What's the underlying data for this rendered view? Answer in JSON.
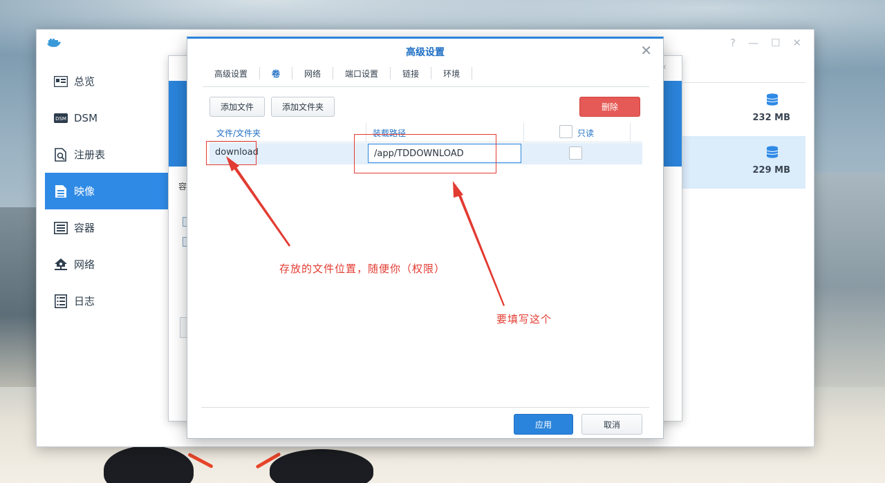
{
  "main_window": {
    "sidebar": [
      {
        "label": "总览",
        "icon": "overview-icon"
      },
      {
        "label": "DSM",
        "icon": "dsm-icon"
      },
      {
        "label": "注册表",
        "icon": "registry-icon"
      },
      {
        "label": "映像",
        "icon": "image-icon"
      },
      {
        "label": "容器",
        "icon": "container-icon"
      },
      {
        "label": "网络",
        "icon": "network-icon"
      },
      {
        "label": "日志",
        "icon": "log-icon"
      }
    ],
    "active_item": "映像",
    "image_sizes": [
      "232 MB",
      "229 MB"
    ]
  },
  "background_window": {
    "partial_label": "容"
  },
  "dialog": {
    "title": "高级设置",
    "tabs": [
      "高级设置",
      "卷",
      "网络",
      "端口设置",
      "链接",
      "环境"
    ],
    "active_tab": "卷",
    "toolbar": {
      "add_file": "添加文件",
      "add_folder": "添加文件夹",
      "delete": "删除"
    },
    "columns": {
      "folder": "文件/文件夹",
      "mount_path": "装载路径",
      "readonly": "只读"
    },
    "rows": [
      {
        "folder": "download",
        "mount_path": "/app/TDDOWNLOAD",
        "readonly": false
      }
    ],
    "footer": {
      "apply": "应用",
      "cancel": "取消"
    }
  },
  "annotations": {
    "note_folder": "存放的文件位置，随便你（权限）",
    "note_path": "要填写这个"
  },
  "colors": {
    "accent": "#2b84db",
    "danger": "#e55a56",
    "annotation": "#e23b32"
  }
}
